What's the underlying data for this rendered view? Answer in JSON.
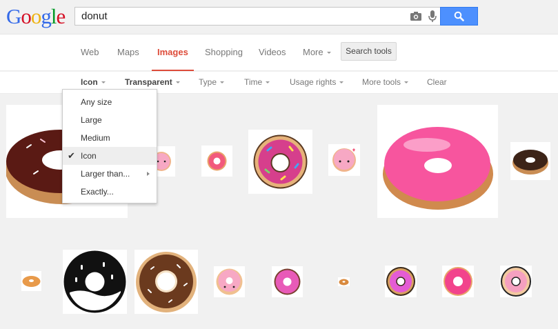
{
  "logo": {
    "letters": [
      "G",
      "o",
      "o",
      "g",
      "l",
      "e"
    ]
  },
  "search": {
    "value": "donut"
  },
  "nav": {
    "tabs": [
      {
        "label": "Web"
      },
      {
        "label": "Maps"
      },
      {
        "label": "Images"
      },
      {
        "label": "Shopping"
      },
      {
        "label": "Videos"
      },
      {
        "label": "More"
      }
    ],
    "search_tools": "Search tools"
  },
  "tools": {
    "items": [
      {
        "label": "Icon"
      },
      {
        "label": "Transparent"
      },
      {
        "label": "Type"
      },
      {
        "label": "Time"
      },
      {
        "label": "Usage rights"
      },
      {
        "label": "More tools"
      },
      {
        "label": "Clear"
      }
    ]
  },
  "size_menu": {
    "items": [
      {
        "label": "Any size"
      },
      {
        "label": "Large"
      },
      {
        "label": "Medium"
      },
      {
        "label": "Icon",
        "checked": true
      },
      {
        "label": "Larger than..."
      },
      {
        "label": "Exactly..."
      }
    ],
    "check_glyph": "✔"
  },
  "colors": {
    "active_tab": "#dd4b39",
    "search_button": "#4d90fe",
    "pink_frosting": "#f7559e",
    "chocolate": "#4a2a1c"
  },
  "icons": [
    "camera-icon",
    "mic-icon",
    "magnifier-icon",
    "checkmark-icon",
    "submenu-arrow-icon"
  ]
}
